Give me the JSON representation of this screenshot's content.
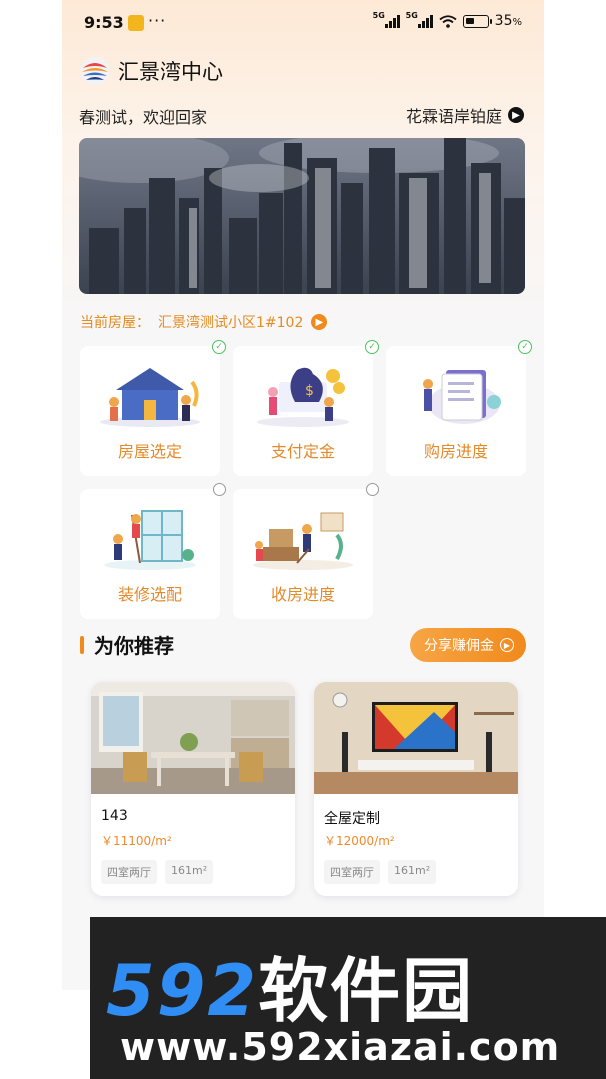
{
  "status_bar": {
    "time": "9:53",
    "more": "···",
    "network_1": "5G",
    "network_2": "5G",
    "battery": "35",
    "battery_unit": "%"
  },
  "header": {
    "app_title": "汇景湾中心",
    "welcome": "春测试，欢迎回家",
    "project_name": "花霖语岸铂庭"
  },
  "current_house": {
    "label": "当前房屋：",
    "value": "汇景湾测试小区1#102"
  },
  "features": [
    {
      "label": "房屋选定",
      "status": "done"
    },
    {
      "label": "支付定金",
      "status": "done"
    },
    {
      "label": "购房进度",
      "status": "done"
    },
    {
      "label": "装修选配",
      "status": "pending"
    },
    {
      "label": "收房进度",
      "status": "pending"
    }
  ],
  "recommend": {
    "title": "为你推荐",
    "share_button": "分享赚佣金",
    "houses": [
      {
        "name": "143",
        "price": "￥11100/m²",
        "tags": [
          "四室两厅",
          "161m²"
        ]
      },
      {
        "name": "全屋定制",
        "price": "￥12000/m²",
        "tags": [
          "四室两厅",
          "161m²"
        ]
      }
    ]
  },
  "watermark": {
    "brand_num": "592",
    "brand_cn": "软件园",
    "url": "www.592xiazai.com"
  },
  "colors": {
    "accent": "#f08a1c",
    "feature_label": "#e38a2b",
    "check": "#4cc25c",
    "watermark_blue": "#2f8df3"
  }
}
